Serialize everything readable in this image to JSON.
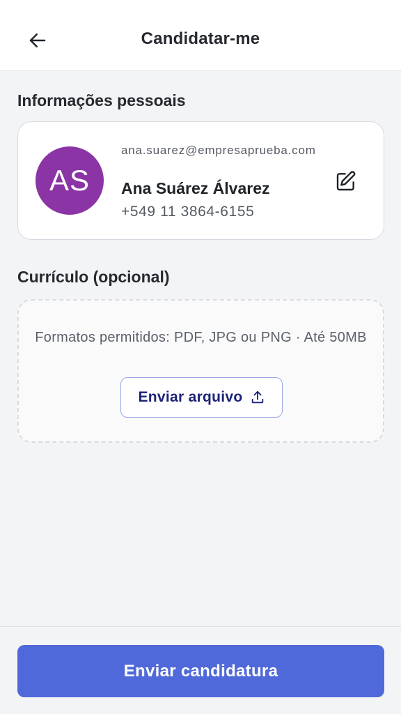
{
  "header": {
    "title": "Candidatar-me",
    "back_icon": "arrow-left-icon"
  },
  "personal": {
    "section_title": "Informações pessoais",
    "avatar_initials": "AS",
    "avatar_color": "#8b34a6",
    "email": "ana.suarez@empresaprueba.com",
    "name": "Ana Suárez Álvarez",
    "phone": "+549 11 3864-6155",
    "edit_icon": "pencil-edit-icon"
  },
  "resume": {
    "section_title": "Currículo (opcional)",
    "formats_text": "Formatos permitidos: PDF, JPG ou PNG · Até 50MB",
    "upload_label": "Enviar arquivo",
    "upload_icon": "upload-icon"
  },
  "footer": {
    "submit_label": "Enviar candidatura",
    "accent_color": "#5069da"
  }
}
